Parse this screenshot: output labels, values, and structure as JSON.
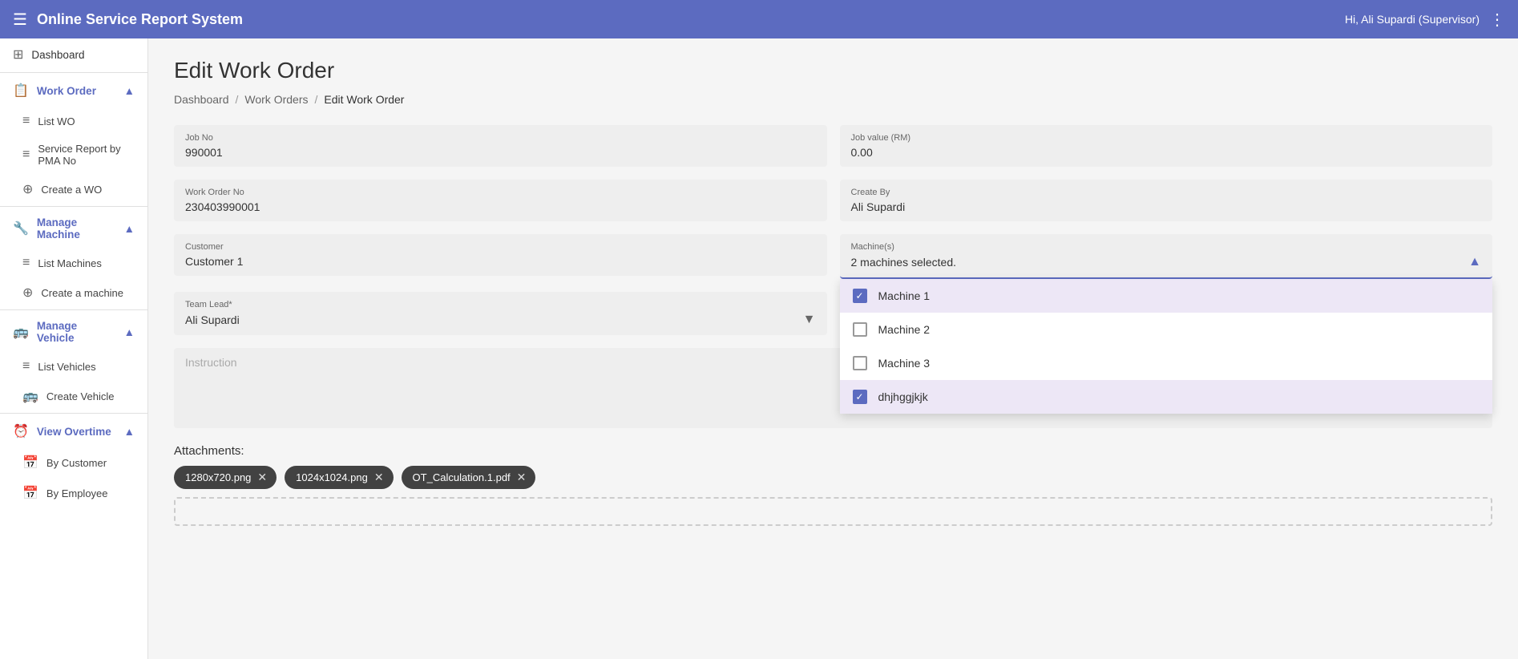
{
  "app": {
    "title": "Online Service Report System",
    "user": "Hi, Ali Supardi (Supervisor)"
  },
  "sidebar": {
    "dashboard": "Dashboard",
    "workOrder": {
      "label": "Work Order",
      "items": [
        "List WO",
        "Service Report by PMA No",
        "Create a WO"
      ]
    },
    "manageMachine": {
      "label": "Manage Machine",
      "items": [
        "List Machines",
        "Create a machine"
      ]
    },
    "manageVehicle": {
      "label": "Manage Vehicle",
      "items": [
        "List Vehicles",
        "Create Vehicle"
      ]
    },
    "viewOvertime": {
      "label": "View Overtime",
      "items": [
        "By Customer",
        "By Employee"
      ]
    }
  },
  "breadcrumb": {
    "items": [
      "Dashboard",
      "Work Orders",
      "Edit Work Order"
    ]
  },
  "page": {
    "title": "Edit Work Order"
  },
  "form": {
    "jobNo": {
      "label": "Job No",
      "value": "990001"
    },
    "jobValue": {
      "label": "Job value (RM)",
      "value": "0.00"
    },
    "workOrderNo": {
      "label": "Work Order No",
      "value": "230403990001"
    },
    "createBy": {
      "label": "Create By",
      "value": "Ali Supardi"
    },
    "customer": {
      "label": "Customer",
      "value": "Customer 1"
    },
    "teamLead": {
      "label": "Team Lead*",
      "value": "Ali Supardi"
    },
    "machines": {
      "label": "Machine(s)",
      "selectedText": "2 machines selected.",
      "options": [
        {
          "label": "Machine 1",
          "checked": true
        },
        {
          "label": "Machine 2",
          "checked": false
        },
        {
          "label": "Machine 3",
          "checked": false
        },
        {
          "label": "dhjhggjkjk",
          "checked": true
        }
      ]
    },
    "instruction": {
      "placeholder": "Instruction"
    }
  },
  "attachments": {
    "label": "Attachments:",
    "files": [
      {
        "name": "1280x720.png"
      },
      {
        "name": "1024x1024.png"
      },
      {
        "name": "OT_Calculation.1.pdf"
      }
    ]
  }
}
